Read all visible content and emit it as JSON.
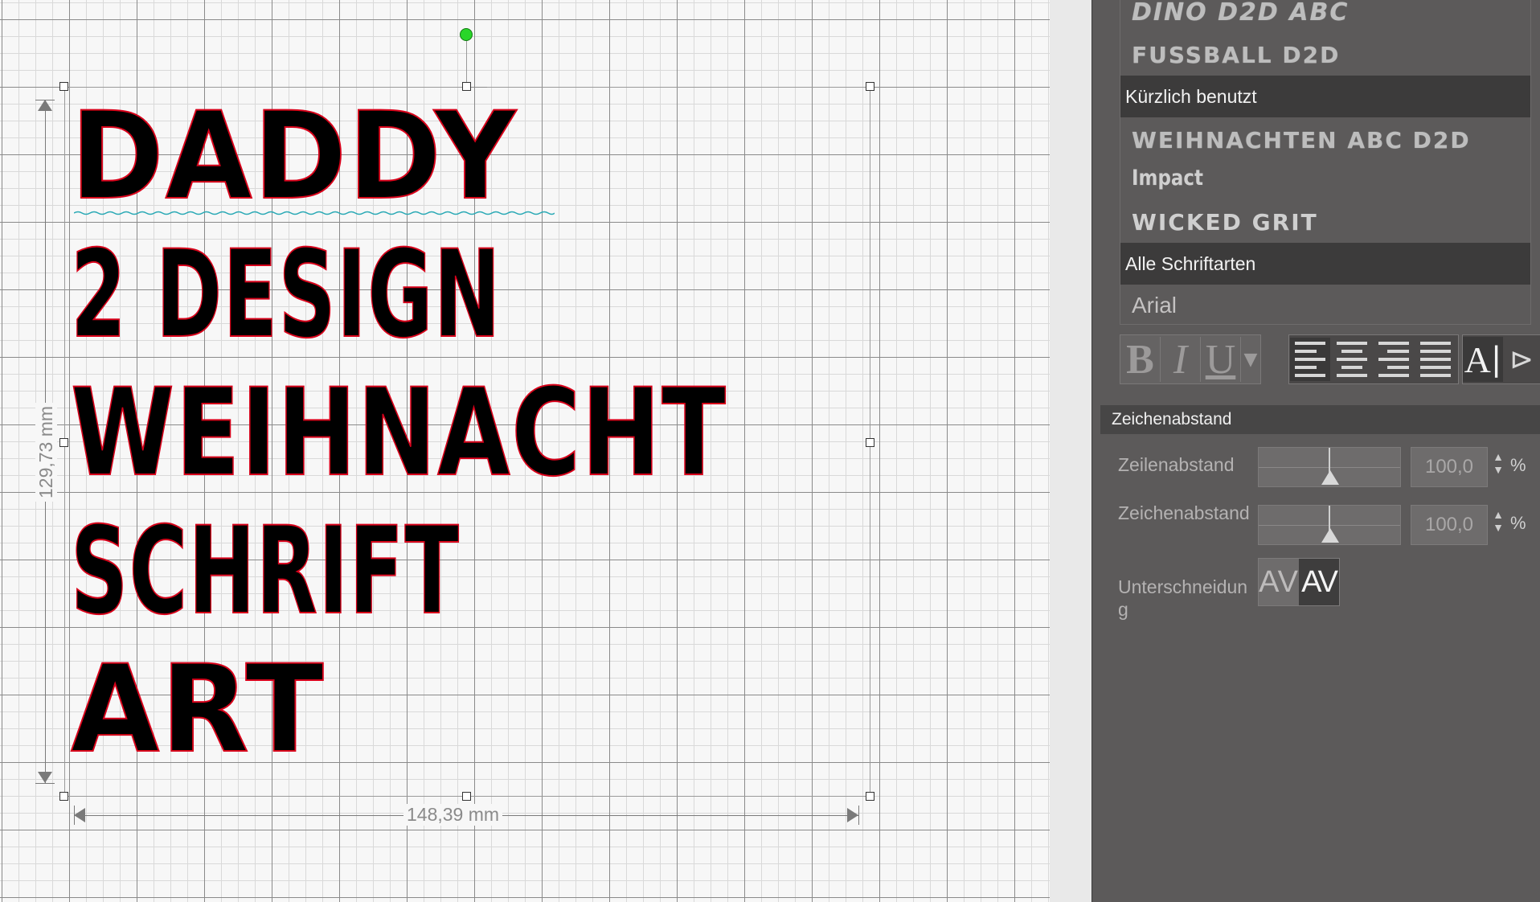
{
  "canvas": {
    "design_lines": [
      "DADDY",
      "2 DESIGN",
      "WEIHNACHT",
      "SCHRIFT",
      "ART"
    ],
    "dimension_width": "148,39 mm",
    "dimension_height": "129,73 mm"
  },
  "font_panel": {
    "top_fonts": [
      "DINO D2D ABC",
      "FUSSBALL D2D"
    ],
    "recent_header": "Kürzlich benutzt",
    "recent_fonts": [
      "WEIHNACHTEN ABC D2D",
      "Impact",
      "WICKED GRIT"
    ],
    "all_header": "Alle Schriftarten",
    "all_fonts": [
      "Arial"
    ]
  },
  "format_toolbar": {
    "bold": "B",
    "italic": "I",
    "underline": "U",
    "dropdown": "▼",
    "text_mode": "A"
  },
  "spacing": {
    "header": "Zeichenabstand",
    "line_spacing_label": "Zeilenabstand",
    "line_spacing_value": "100,0",
    "char_spacing_label": "Zeichenabstand",
    "char_spacing_value": "100,0",
    "unit": "%",
    "kerning_label": "Unterschneidung",
    "kerning_off": "AV",
    "kerning_on": "AV"
  },
  "colors": {
    "outline": "#d8001a",
    "handle_rotate": "#29d629",
    "panel_bg": "#5c5a5a"
  }
}
